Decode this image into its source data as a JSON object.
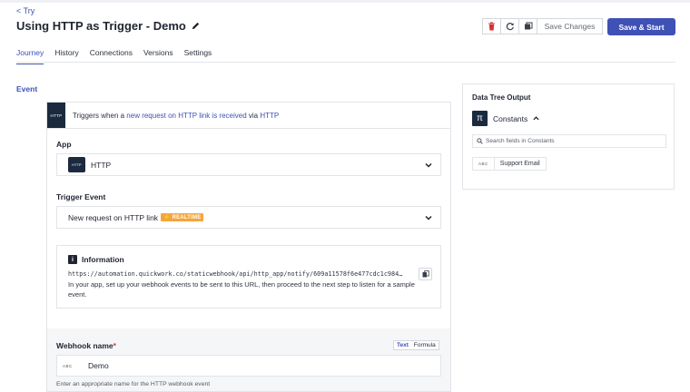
{
  "nav": {
    "back_label": "< Try"
  },
  "header": {
    "title": "Using HTTP as Trigger - Demo",
    "save_changes_label": "Save Changes",
    "save_start_label": "Save & Start"
  },
  "tabs": [
    {
      "label": "Journey",
      "active": true
    },
    {
      "label": "History",
      "active": false
    },
    {
      "label": "Connections",
      "active": false
    },
    {
      "label": "Versions",
      "active": false
    },
    {
      "label": "Settings",
      "active": false
    }
  ],
  "event": {
    "section_label": "Event",
    "trigger_logo_text": "HTTP",
    "trigger_prefix": "Triggers when a",
    "trigger_link": "new request on HTTP link is received",
    "trigger_via": "via",
    "trigger_app_link": "HTTP",
    "app_label": "App",
    "app_logo_text": "HTTP",
    "app_value": "HTTP",
    "trigger_event_label": "Trigger Event",
    "trigger_event_value": "New request on HTTP link",
    "realtime_badge": "⚡ REALTIME",
    "info_title": "Information",
    "info_icon_text": "i",
    "webhook_url": "https://automation.quickwork.co/staticwebhook/api/http_app/notify/609a11578f6e477cdc1c984...",
    "info_description": "In your app, set up your webhook events to be sent to this URL, then proceed to the next step to listen for a sample event.",
    "webhook_name_label": "Webhook name",
    "required_mark": "*",
    "mode_text": "Text",
    "mode_formula": "Formula",
    "type_tag": "ABC",
    "webhook_name_value": "Demo",
    "webhook_hint": "Enter an appropriate name for the HTTP webhook event"
  },
  "data_tree": {
    "title": "Data Tree Output",
    "group_icon_text": "π",
    "group_label": "Constants",
    "search_placeholder": "Search fields in Constants",
    "items": [
      {
        "type": "ABC",
        "name": "Support Email"
      }
    ]
  },
  "colors": {
    "accent": "#3f51b5",
    "realtime": "#f5a53d",
    "danger": "#d33333",
    "logo_bg": "#1b2a3f"
  }
}
